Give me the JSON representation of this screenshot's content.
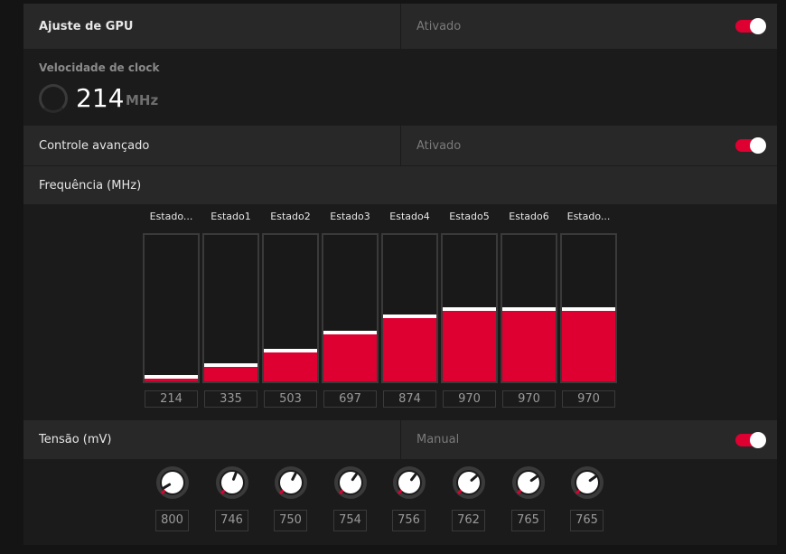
{
  "gpu_tuning": {
    "title": "Ajuste de GPU",
    "state": "Ativado",
    "enabled": true
  },
  "clock": {
    "title": "Velocidade de clock",
    "value": "214",
    "unit": "MHz"
  },
  "advanced": {
    "title": "Controle avançado",
    "state": "Ativado",
    "enabled": true
  },
  "frequency": {
    "title": "Frequência (MHz)",
    "max_value": 1100,
    "states": [
      {
        "label": "Estado...",
        "value": 214,
        "level": 0.02
      },
      {
        "label": "Estado1",
        "value": 335,
        "level": 0.1
      },
      {
        "label": "Estado2",
        "value": 503,
        "level": 0.2
      },
      {
        "label": "Estado3",
        "value": 697,
        "level": 0.32
      },
      {
        "label": "Estado4",
        "value": 874,
        "level": 0.43
      },
      {
        "label": "Estado5",
        "value": 970,
        "level": 0.48
      },
      {
        "label": "Estado6",
        "value": 970,
        "level": 0.48
      },
      {
        "label": "Estado...",
        "value": 970,
        "level": 0.48
      }
    ]
  },
  "voltage": {
    "title": "Tensão (mV)",
    "state": "Manual",
    "enabled": true,
    "values": [
      800,
      746,
      750,
      754,
      756,
      762,
      765,
      765
    ],
    "levels": [
      0.05,
      0.58,
      0.6,
      0.63,
      0.64,
      0.68,
      0.7,
      0.7
    ]
  },
  "colors": {
    "accent": "#dd0031",
    "panel": "#1b1b1b",
    "row_header": "#282828"
  }
}
